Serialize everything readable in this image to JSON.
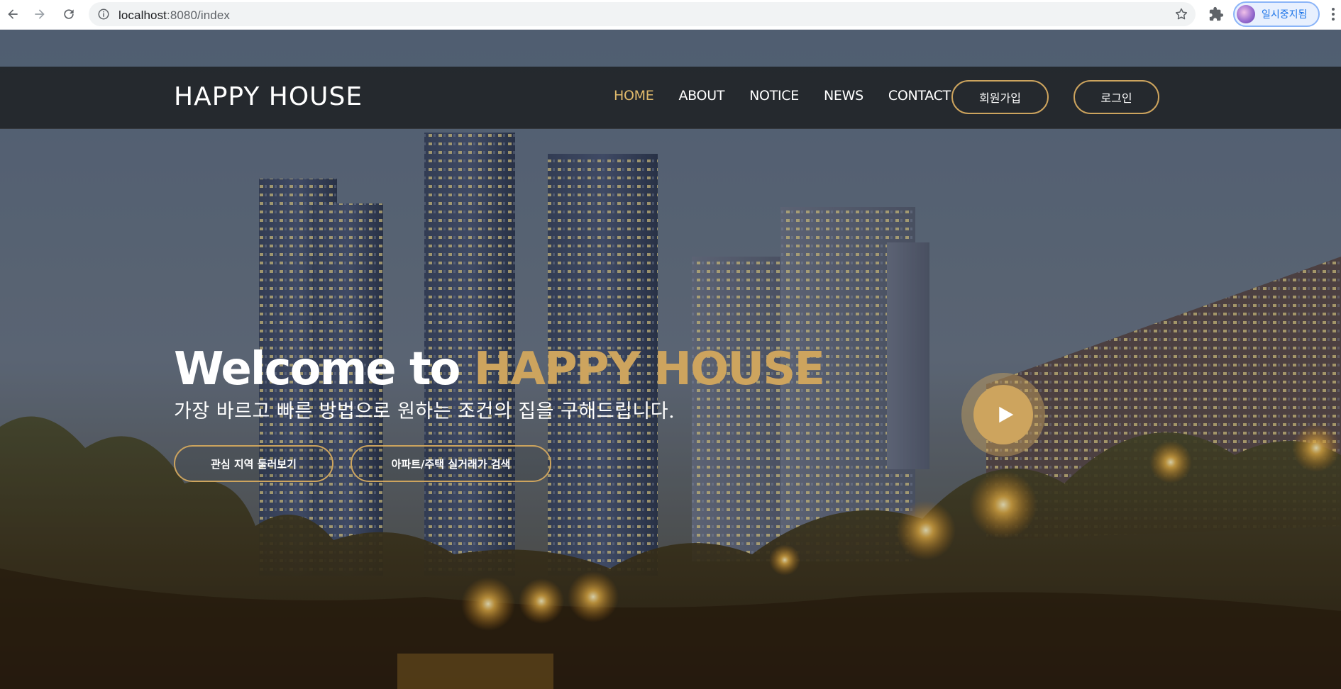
{
  "browser": {
    "url_host": "localhost",
    "url_rest": ":8080/index",
    "profile_label": "일시중지됨"
  },
  "site": {
    "brand": "HAPPY HOUSE",
    "nav": [
      {
        "label": "HOME",
        "active": true
      },
      {
        "label": "ABOUT",
        "active": false
      },
      {
        "label": "NOTICE",
        "active": false
      },
      {
        "label": "NEWS",
        "active": false
      },
      {
        "label": "CONTACT",
        "active": false
      }
    ],
    "signup_label": "회원가입",
    "login_label": "로그인"
  },
  "hero": {
    "welcome_prefix": "Welcome to ",
    "welcome_accent": "HAPPY HOUSE",
    "subtitle": "가장 바르고 빠른 방법으로 원하는 조건의 집을 구해드립니다.",
    "cta_region": "관심 지역 둘러보기",
    "cta_search": "아파트/주택 실거래가 검색"
  },
  "colors": {
    "accent": "#cda45e",
    "nav_active": "#e0b96b",
    "header_bg": "#212529"
  },
  "icons": {
    "back": "back-arrow-icon",
    "forward": "forward-arrow-icon",
    "reload": "reload-icon",
    "info": "info-icon",
    "bookmark": "star-icon",
    "extensions": "puzzle-icon",
    "menu": "menu-dots-icon",
    "play": "play-icon"
  }
}
